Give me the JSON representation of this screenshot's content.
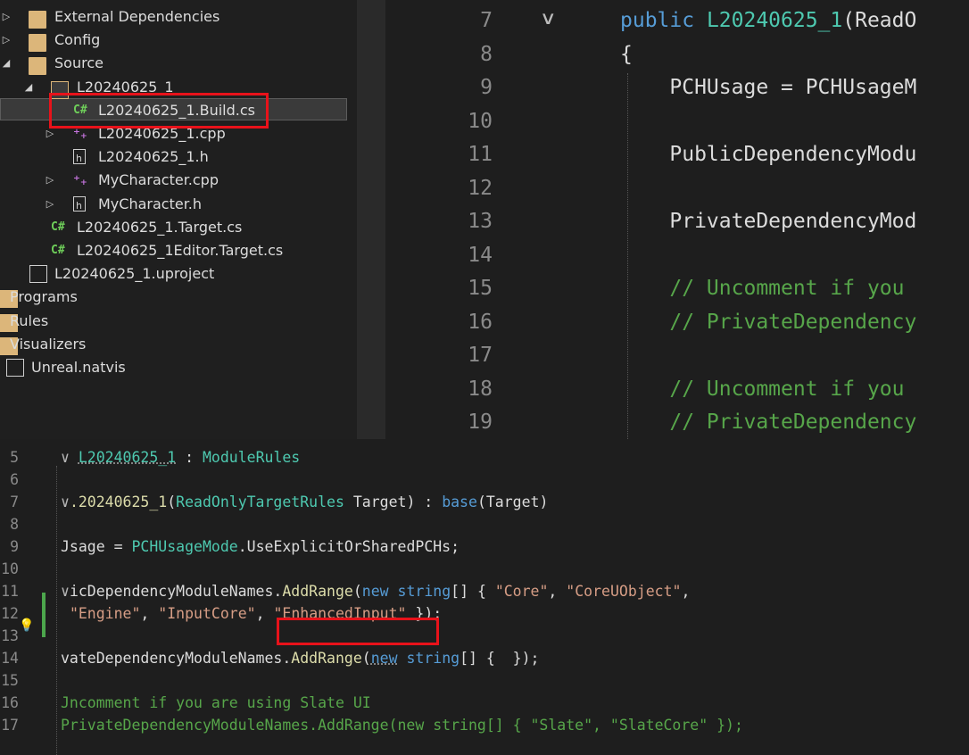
{
  "solution_explorer": {
    "items": [
      {
        "label": "External Dependencies",
        "icon": "external-dependencies-icon",
        "arrow": "▷"
      },
      {
        "label": "Config",
        "icon": "filter-folder-icon",
        "arrow": "▷"
      },
      {
        "label": "Source",
        "icon": "filter-folder-icon",
        "arrow": "◢"
      },
      {
        "label": "L20240625_1",
        "icon": "filter-folder-open-icon",
        "arrow": "◢"
      },
      {
        "label": "L20240625_1.Build.cs",
        "icon": "csharp-file-icon",
        "csharp": "C#",
        "selected": true
      },
      {
        "label": "L20240625_1.cpp",
        "icon": "cpp-file-icon",
        "cpp": "⁺₊",
        "arrow": "▷"
      },
      {
        "label": "L20240625_1.h",
        "icon": "header-file-icon"
      },
      {
        "label": "MyCharacter.cpp",
        "icon": "cpp-file-icon",
        "cpp": "⁺₊",
        "arrow": "▷"
      },
      {
        "label": "MyCharacter.h",
        "icon": "header-file-icon",
        "arrow": "▷"
      },
      {
        "label": "L20240625_1.Target.cs",
        "icon": "csharp-file-icon",
        "csharp": "C#"
      },
      {
        "label": "L20240625_1Editor.Target.cs",
        "icon": "csharp-file-icon",
        "csharp": "C#"
      },
      {
        "label": "L20240625_1.uproject",
        "icon": "document-icon"
      },
      {
        "label": "Programs",
        "icon": "folder-icon"
      },
      {
        "label": "Rules",
        "icon": "folder-icon"
      },
      {
        "label": "Visualizers",
        "icon": "folder-icon"
      },
      {
        "label": "Unreal.natvis",
        "icon": "natvis-file-icon"
      }
    ]
  },
  "top_editor": {
    "fold_marker": "∨",
    "lines": [
      {
        "num": "7",
        "tokens": [
          [
            "kw",
            "public "
          ],
          [
            "ty",
            "L20240625_1"
          ],
          [
            "id",
            "(ReadO"
          ]
        ]
      },
      {
        "num": "8",
        "tokens": [
          [
            "id",
            "{"
          ]
        ]
      },
      {
        "num": "9",
        "tokens": [
          [
            "id",
            "    PCHUsage = PCHUsageM"
          ]
        ]
      },
      {
        "num": "10",
        "tokens": []
      },
      {
        "num": "11",
        "tokens": [
          [
            "id",
            "    PublicDependencyModu"
          ]
        ]
      },
      {
        "num": "12",
        "tokens": []
      },
      {
        "num": "13",
        "tokens": [
          [
            "id",
            "    PrivateDependencyMod"
          ]
        ]
      },
      {
        "num": "14",
        "tokens": []
      },
      {
        "num": "15",
        "tokens": [
          [
            "cm",
            "    // Uncomment if you "
          ]
        ]
      },
      {
        "num": "16",
        "tokens": [
          [
            "cm",
            "    // PrivateDependency"
          ]
        ]
      },
      {
        "num": "17",
        "tokens": []
      },
      {
        "num": "18",
        "tokens": [
          [
            "cm",
            "    // Uncomment if you "
          ]
        ]
      },
      {
        "num": "19",
        "tokens": [
          [
            "cm",
            "    // PrivateDependency"
          ]
        ]
      }
    ]
  },
  "bottom_editor": {
    "lightbulb": "💡",
    "lines": [
      {
        "num": "5",
        "tokens": [
          [
            "pl",
            "∨ "
          ],
          [
            "ty",
            "L20240625_1"
          ],
          [
            "id",
            " : "
          ],
          [
            "ty",
            "ModuleRules"
          ]
        ]
      },
      {
        "num": "6",
        "tokens": []
      },
      {
        "num": "7",
        "tokens": [
          [
            "pl",
            "∨"
          ],
          [
            "fn",
            ".20240625_1"
          ],
          [
            "id",
            "("
          ],
          [
            "ty",
            "ReadOnlyTargetRules"
          ],
          [
            "id",
            " Target) : "
          ],
          [
            "kw",
            "base"
          ],
          [
            "id",
            "(Target)"
          ]
        ]
      },
      {
        "num": "8",
        "tokens": []
      },
      {
        "num": "9",
        "tokens": [
          [
            "id",
            "Jsage = "
          ],
          [
            "ty",
            "PCHUsageMode"
          ],
          [
            "id",
            ".UseExplicitOrSharedPCHs;"
          ]
        ]
      },
      {
        "num": "10",
        "tokens": []
      },
      {
        "num": "11",
        "tokens": [
          [
            "pl",
            "∨"
          ],
          [
            "id",
            "icDependencyModuleNames."
          ],
          [
            "fn",
            "AddRange"
          ],
          [
            "id",
            "("
          ],
          [
            "kw",
            "new"
          ],
          [
            "id",
            " "
          ],
          [
            "kw",
            "string"
          ],
          [
            "id",
            "[] { "
          ],
          [
            "str",
            "\"Core\""
          ],
          [
            "id",
            ", "
          ],
          [
            "str",
            "\"CoreUObject\""
          ],
          [
            "id",
            ","
          ]
        ]
      },
      {
        "num": "12",
        "tokens": [
          [
            "id",
            " "
          ],
          [
            "str",
            "\"Engine\""
          ],
          [
            "id",
            ", "
          ],
          [
            "str",
            "\"InputCore\""
          ],
          [
            "id",
            ", "
          ],
          [
            "str",
            "\"EnhancedInput\""
          ],
          [
            "id",
            " });"
          ]
        ]
      },
      {
        "num": "13",
        "tokens": []
      },
      {
        "num": "14",
        "tokens": [
          [
            "id",
            "vateDependencyModuleNames."
          ],
          [
            "fn",
            "AddRange"
          ],
          [
            "id",
            "("
          ],
          [
            "kw",
            "new"
          ],
          [
            "id",
            " "
          ],
          [
            "kw",
            "string"
          ],
          [
            "id",
            "[] {  });"
          ]
        ]
      },
      {
        "num": "15",
        "tokens": []
      },
      {
        "num": "16",
        "tokens": [
          [
            "cm",
            "Jncomment if you are using Slate UI"
          ]
        ]
      },
      {
        "num": "17",
        "tokens": [
          [
            "cm",
            "PrivateDependencyModuleNames.AddRange(new string[] { \"Slate\", \"SlateCore\" });"
          ]
        ]
      }
    ]
  }
}
